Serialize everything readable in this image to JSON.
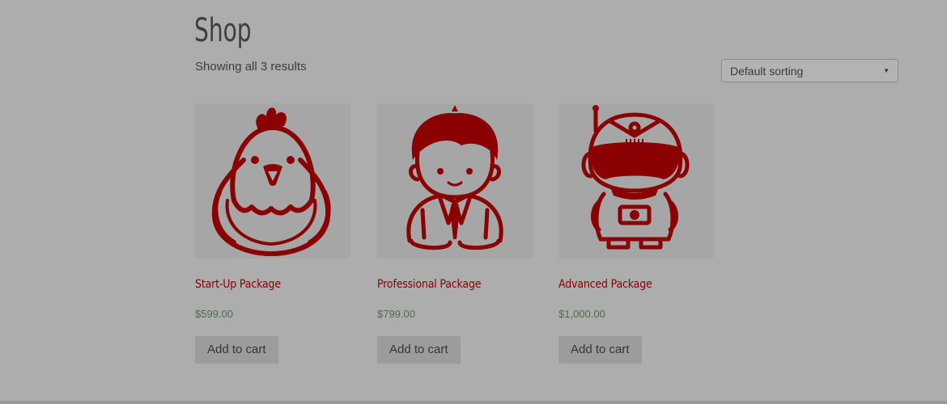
{
  "page": {
    "title": "Shop",
    "result_count": "Showing all 3 results"
  },
  "sorting": {
    "selected": "Default sorting",
    "arrow_icon": "triangle-down-icon"
  },
  "products": [
    {
      "title": "Start-Up Package",
      "price": "$599.00",
      "button": "Add to cart",
      "illustration": "chicken-icon"
    },
    {
      "title": "Professional Package",
      "price": "$799.00",
      "button": "Add to cart",
      "illustration": "businessman-icon"
    },
    {
      "title": "Advanced Package",
      "price": "$1,000.00",
      "button": "Add to cart",
      "illustration": "astronaut-icon"
    }
  ],
  "colors": {
    "background": "#adadad",
    "accent": "#8b0000",
    "price": "#4f6a4f",
    "button_bg": "#9c9c9c"
  }
}
